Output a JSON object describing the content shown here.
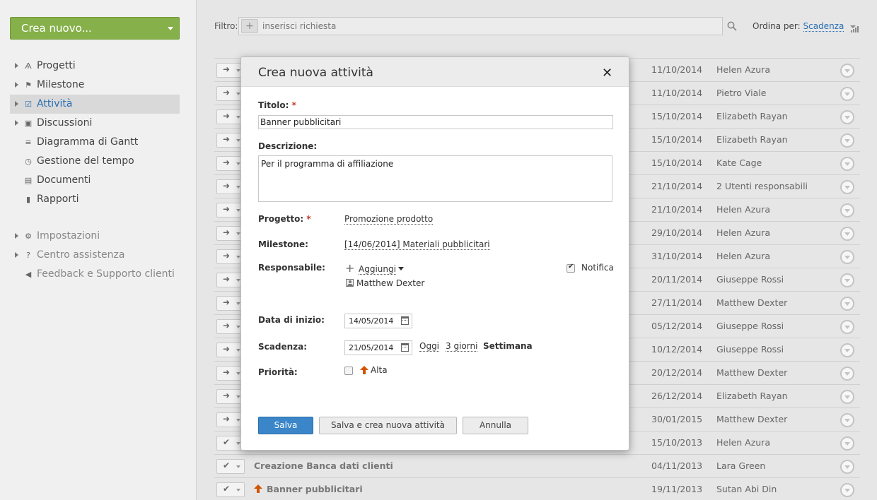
{
  "sidebar": {
    "create_label": "Crea nuovo...",
    "items": [
      {
        "label": "Progetti",
        "icon": "compass-icon",
        "glyph": "Ѧ",
        "arrow": true,
        "active": false
      },
      {
        "label": "Milestone",
        "icon": "flag-icon",
        "glyph": "⚑",
        "arrow": true,
        "active": false
      },
      {
        "label": "Attività",
        "icon": "checkbox-icon",
        "glyph": "☑",
        "arrow": true,
        "active": true
      },
      {
        "label": "Discussioni",
        "icon": "speech-bubble-icon",
        "glyph": "▣",
        "arrow": true,
        "active": false
      },
      {
        "label": "Diagramma di Gantt",
        "icon": "gantt-icon",
        "glyph": "≡",
        "arrow": false,
        "active": false
      },
      {
        "label": "Gestione del tempo",
        "icon": "clock-icon",
        "glyph": "◷",
        "arrow": false,
        "active": false
      },
      {
        "label": "Documenti",
        "icon": "document-icon",
        "glyph": "▤",
        "arrow": false,
        "active": false
      },
      {
        "label": "Rapporti",
        "icon": "bar-chart-icon",
        "glyph": "▮",
        "arrow": false,
        "active": false
      }
    ],
    "secondary": [
      {
        "label": "Impostazioni",
        "icon": "gear-icon",
        "glyph": "⚙",
        "arrow": true
      },
      {
        "label": "Centro assistenza",
        "icon": "question-icon",
        "glyph": "?",
        "arrow": true
      },
      {
        "label": "Feedback e Supporto clienti",
        "icon": "megaphone-icon",
        "glyph": "◀",
        "arrow": false
      }
    ]
  },
  "toolbar": {
    "filter_label": "Filtro:",
    "filter_placeholder": "inserisci richiesta",
    "sort_label": "Ordina per:",
    "sort_value": "Scadenza"
  },
  "tasks": [
    {
      "date": "11/10/2014",
      "person": "Helen Azura",
      "title": "",
      "done": false,
      "high": false
    },
    {
      "date": "11/10/2014",
      "person": "Pietro Viale",
      "title": "",
      "done": false,
      "high": false
    },
    {
      "date": "15/10/2014",
      "person": "Elizabeth Rayan",
      "title": "",
      "done": false,
      "high": false
    },
    {
      "date": "15/10/2014",
      "person": "Elizabeth Rayan",
      "title": "",
      "done": false,
      "high": false
    },
    {
      "date": "15/10/2014",
      "person": "Kate Cage",
      "title": "",
      "done": false,
      "high": false
    },
    {
      "date": "21/10/2014",
      "person": "2 Utenti responsabili",
      "title": "",
      "done": false,
      "high": false
    },
    {
      "date": "21/10/2014",
      "person": "Helen Azura",
      "title": "",
      "done": false,
      "high": false
    },
    {
      "date": "29/10/2014",
      "person": "Helen Azura",
      "title": "",
      "done": false,
      "high": false
    },
    {
      "date": "31/10/2014",
      "person": "Helen Azura",
      "title": "",
      "done": false,
      "high": false
    },
    {
      "date": "20/11/2014",
      "person": "Giuseppe Rossi",
      "title": "",
      "done": false,
      "high": false
    },
    {
      "date": "27/11/2014",
      "person": "Matthew Dexter",
      "title": "",
      "done": false,
      "high": false
    },
    {
      "date": "05/12/2014",
      "person": "Giuseppe Rossi",
      "title": "",
      "done": false,
      "high": false
    },
    {
      "date": "10/12/2014",
      "person": "Giuseppe Rossi",
      "title": "",
      "done": false,
      "high": false
    },
    {
      "date": "20/12/2014",
      "person": "Matthew Dexter",
      "title": "",
      "done": false,
      "high": false
    },
    {
      "date": "26/12/2014",
      "person": "Elizabeth Rayan",
      "title": "",
      "done": false,
      "high": false
    },
    {
      "date": "30/01/2015",
      "person": "Matthew Dexter",
      "title": "",
      "done": false,
      "high": false
    },
    {
      "date": "15/10/2013",
      "person": "Helen Azura",
      "title": "",
      "done": true,
      "high": false
    },
    {
      "date": "04/11/2013",
      "person": "Lara Green",
      "title": "Creazione Banca dati clienti",
      "done": true,
      "high": false
    },
    {
      "date": "19/11/2013",
      "person": "Sutan Abi Din",
      "title": "Banner pubblicitari",
      "done": true,
      "high": true
    }
  ],
  "modal": {
    "title": "Crea nuova attività",
    "title_label": "Titolo:",
    "title_value": "Banner pubblicitari",
    "desc_label": "Descrizione:",
    "desc_value": "Per il programma di affiliazione",
    "project_label": "Progetto:",
    "project_value": "Promozione prodotto",
    "milestone_label": "Milestone:",
    "milestone_value": "[14/06/2014] Materiali pubblicitari",
    "responsible_label": "Responsabile:",
    "add_label": "Aggiungi",
    "notify_label": "Notifica",
    "notify_checked": true,
    "assignee": "Matthew Dexter",
    "start_label": "Data di inizio:",
    "start_value": "14/05/2014",
    "due_label": "Scadenza:",
    "due_value": "21/05/2014",
    "quick_today": "Oggi",
    "quick_3days": "3 giorni",
    "quick_week": "Settimana",
    "priority_label": "Priorità:",
    "priority_value": "Alta",
    "priority_checked": false,
    "save_label": "Salva",
    "save_new_label": "Salva e crea nuova attività",
    "cancel_label": "Annulla",
    "required_mark": "*"
  },
  "colors": {
    "accent_green": "#86b04a",
    "accent_blue": "#2a6fb3",
    "primary_button": "#3a86c8",
    "priority_high": "#d35400"
  }
}
